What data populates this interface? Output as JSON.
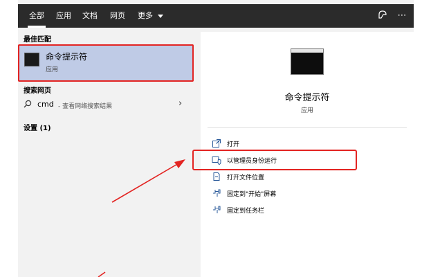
{
  "tabs": [
    {
      "label": "全部",
      "active": true
    },
    {
      "label": "应用",
      "active": false
    },
    {
      "label": "文档",
      "active": false
    },
    {
      "label": "网页",
      "active": false
    },
    {
      "label": "更多",
      "active": false
    }
  ],
  "toolbar": {
    "feedback_icon": "feedback-icon",
    "more_icon": "more-options-icon"
  },
  "left": {
    "best_match_heading": "最佳匹配",
    "best_match": {
      "title": "命令提示符",
      "subtitle": "应用",
      "icon": "command-prompt-icon"
    },
    "web_heading": "搜索网页",
    "web_result": {
      "query": "cmd",
      "hint": "- 查看网络搜索结果",
      "icon": "search-icon"
    },
    "settings": "设置 (1)"
  },
  "preview": {
    "title": "命令提示符",
    "subtitle": "应用",
    "actions": [
      {
        "label": "打开",
        "icon": "open-icon"
      },
      {
        "label": "以管理员身份运行",
        "icon": "run-as-admin-icon"
      },
      {
        "label": "打开文件位置",
        "icon": "file-location-icon"
      },
      {
        "label": "固定到\"开始\"屏幕",
        "icon": "pin-icon"
      },
      {
        "label": "固定到任务栏",
        "icon": "pin-icon"
      }
    ]
  },
  "colors": {
    "highlight": "#bfcbe6",
    "annotation_red": "#e32422",
    "tabbar": "#2b2b2b"
  }
}
